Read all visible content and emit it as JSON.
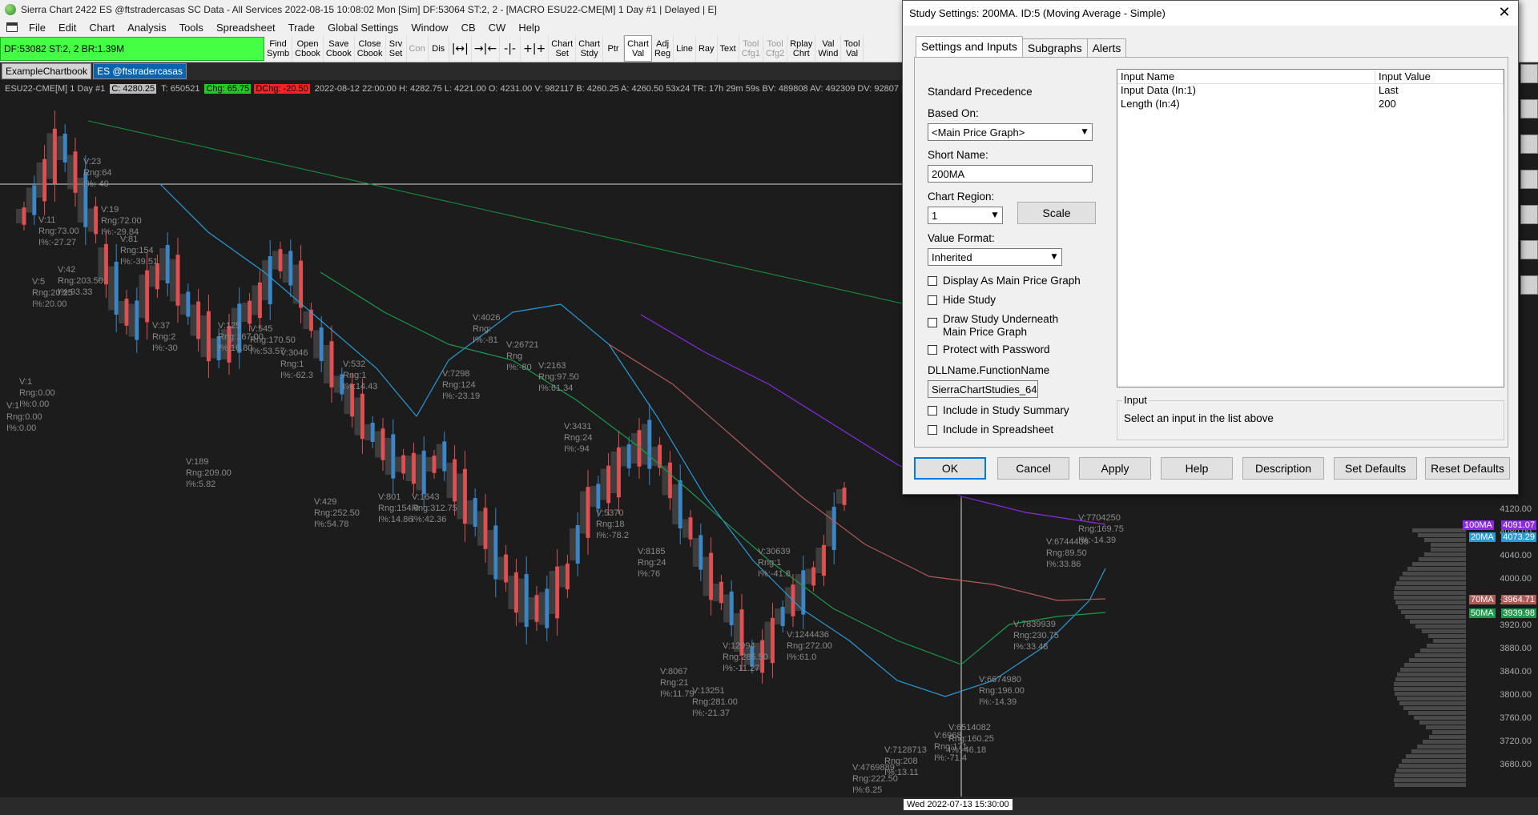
{
  "window": {
    "title": "Sierra Chart 2422 ES @ftstradercasas  SC Data - All Services 2022-08-15  10:08:02 Mon [Sim]  DF:53064  ST:2, 2 - [MACRO ESU22-CME[M]  1 Day  #1 | Delayed | E]"
  },
  "menu": [
    "File",
    "Edit",
    "Chart",
    "Analysis",
    "Tools",
    "Spreadsheet",
    "Trade",
    "Global Settings",
    "Window",
    "CB",
    "CW",
    "Help"
  ],
  "toolbar": {
    "status": "DF:53082  ST:2, 2  BR:1.39M",
    "buttons": [
      {
        "l1": "Find",
        "l2": "Symb"
      },
      {
        "l1": "Open",
        "l2": "Cbook"
      },
      {
        "l1": "Save",
        "l2": "Cbook"
      },
      {
        "l1": "Close",
        "l2": "Cbook"
      },
      {
        "l1": "Srv",
        "l2": "Set"
      },
      {
        "l1": "Con",
        "l2": ""
      },
      {
        "l1": "Dis",
        "l2": ""
      },
      {
        "l1": "Chart",
        "l2": "Set"
      },
      {
        "l1": "Chart",
        "l2": "Stdy"
      },
      {
        "l1": "Ptr",
        "l2": ""
      },
      {
        "l1": "Chart",
        "l2": "Val"
      },
      {
        "l1": "Adj",
        "l2": "Reg"
      },
      {
        "l1": "Line",
        "l2": ""
      },
      {
        "l1": "Ray",
        "l2": ""
      },
      {
        "l1": "Text",
        "l2": ""
      },
      {
        "l1": "Tool",
        "l2": "Cfg1"
      },
      {
        "l1": "Tool",
        "l2": "Cfg2"
      },
      {
        "l1": "Rplay",
        "l2": "Chrt"
      },
      {
        "l1": "Val",
        "l2": "Wind"
      },
      {
        "l1": "Tool",
        "l2": "Val"
      }
    ]
  },
  "tabs": [
    "ExampleChartbook",
    "ES @ftstradercasas"
  ],
  "chart": {
    "header": {
      "symbol": "ESU22-CME[M]  1 Day  #1",
      "close": "C: 4280.25",
      "ticks": "T: 650521",
      "chg": "Chg: 65.75",
      "dchg": "DChg: -20.50",
      "rest": "2022-08-12 22:00:00  H: 4282.75  L: 4221.00  O: 4231.00  V: 982117  B: 4260.25  A: 4260.50  53x24  TR: 17h 29m 59s  BV: 489808  AV: 492309  DV: 92807  D"
    },
    "bar_labels": [
      "V:23\nRng:64\nI%:-40",
      "V:11\nRng:73.00\nI%:-27.27",
      "V:19\nRng:72.00\nI%:-29.84",
      "V:81\nRng:154\nI%:-39.51",
      "V:5\nRng:20.25\nI%:20.00",
      "V:42\nRng:203.50\nI%:93.33",
      "V:37\nRng:2\nI%:-30",
      "V:125\nRng:167.00\nI%:16.80",
      "V:545\nRng:170.50\nI%:53.57",
      "V:3046\nRng:1\nI%:-62.3",
      "V:532\nRng:1\nI%:14.43",
      "V:7298\nRng:124\nI%:-23.19",
      "V:4026\nRng:\nI%:-81",
      "V:26721\nRng\nI%:-80",
      "V:2163\nRng:97.50\nI%:61.34",
      "V:3431\nRng:24\nI%:-94",
      "V:189\nRng:209.00\nI%:5.82",
      "V:429\nRng:252.50\nI%:54.78",
      "V:801\nRng:154.0\nI%:14.86",
      "V:1643\nRng:312.75\nI%:42.36",
      "V:5370\nRng:18\nI%:-78.2",
      "V:8185\nRng:24\nI%:76",
      "V:8067\nRng:21\nI%:11.79",
      "V:13251\nRng:281.00\nI%:-21.37",
      "V:12994\nRng:285.50\nI%:-11.27",
      "V:1244436\nRng:272.00\nI%:61.0",
      "V:30639\nRng:1\nI%:-41.8",
      "V:4769889\nRng:222.50\nI%:6.25",
      "V:7128713\nRng:208\nI%:13.11",
      "V:6968\nRng:171\nI%:-71.4",
      "V:6674980\nRng:196.00\nI%:-14.39",
      "V:6514082\nRng:160.25\nI%:-46.18",
      "V:7839939\nRng:230.75\nI%:33.48",
      "V:6744436\nRng:89.50\nI%:33.86",
      "V:7704250\nRng:169.75\nI%:-14.39",
      "V:1\nRng:0.00\nI%:0.00",
      "V:1\nRng:0.00\nI%:0.00"
    ],
    "price_ticks": [
      "4120.00",
      "4080.00",
      "4040.00",
      "4000.00",
      "3960.00",
      "3920.00",
      "3880.00",
      "3840.00",
      "3800.00",
      "3760.00",
      "3720.00",
      "3680.00"
    ],
    "price_tags": {
      "ma100": "4091.07",
      "ma20": "4073.29",
      "ma70": "3964.71",
      "ma50": "3939.98"
    },
    "ma_labels": {
      "ma100": "100MA",
      "ma20": "20MA",
      "ma70": "70MA",
      "ma50": "50MA"
    },
    "cursor_time": "Wed 2022-07-13  15:30:00",
    "colors": {
      "up": "#3a86c8",
      "down": "#e05050",
      "ma20": "#2a9ad6",
      "ma50": "#1a9a4a",
      "ma70": "#b05a5a",
      "ma100": "#8a2be2",
      "trend": "#1e8f3e"
    }
  },
  "dialog": {
    "title": "Study Settings: 200MA. ID:5 (Moving Average - Simple)",
    "tabs": [
      "Settings and Inputs",
      "Subgraphs",
      "Alerts"
    ],
    "standard_precedence": "Standard Precedence",
    "based_on_label": "Based On:",
    "based_on_value": "<Main Price Graph>",
    "short_name_label": "Short Name:",
    "short_name_value": "200MA",
    "chart_region_label": "Chart Region:",
    "chart_region_value": "1",
    "scale_button": "Scale",
    "value_format_label": "Value Format:",
    "value_format_value": "Inherited",
    "checks": [
      "Display As Main Price Graph",
      "Hide Study",
      "Draw Study Underneath\nMain Price Graph",
      "Protect with Password"
    ],
    "dll_label": "DLLName.FunctionName",
    "dll_value": "SierraChartStudies_64",
    "checks2": [
      "Include in Study Summary",
      "Include in Spreadsheet"
    ],
    "table": {
      "headers": [
        "Input Name",
        "Input Value"
      ],
      "rows": [
        [
          "Input Data  (In:1)",
          "Last"
        ],
        [
          "Length  (In:4)",
          "200"
        ]
      ]
    },
    "input_group": {
      "legend": "Input",
      "hint": "Select an input in the list above"
    },
    "buttons": [
      "OK",
      "Cancel",
      "Apply",
      "Help",
      "Description",
      "Set Defaults",
      "Reset Defaults"
    ]
  }
}
